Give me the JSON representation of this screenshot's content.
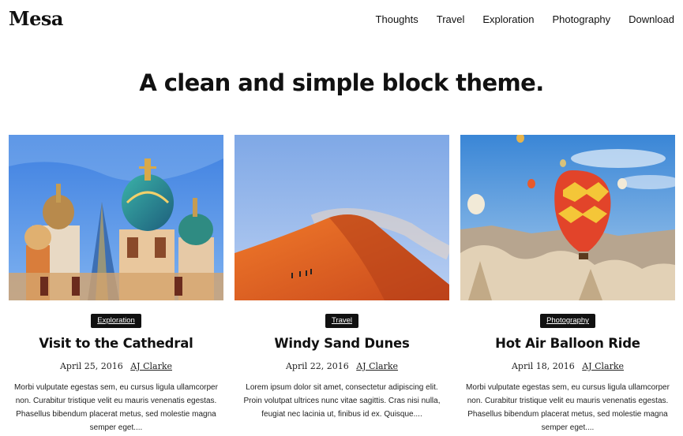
{
  "site": {
    "logo": "Mesa",
    "tagline": "A clean and simple block theme."
  },
  "nav": {
    "items": [
      "Thoughts",
      "Travel",
      "Exploration",
      "Photography",
      "Download"
    ]
  },
  "posts": [
    {
      "category": "Exploration",
      "title": "Visit to the Cathedral",
      "date": "April 25, 2016",
      "author": "AJ Clarke",
      "excerpt": "Morbi vulputate egestas sem, eu cursus ligula ullamcorper non. Curabitur tristique velit eu mauris venenatis egestas. Phasellus bibendum placerat metus, sed molestie magna semper eget....",
      "image": "cathedral-domes-photo"
    },
    {
      "category": "Travel",
      "title": "Windy Sand Dunes",
      "date": "April 22, 2016",
      "author": "AJ Clarke",
      "excerpt": "Lorem ipsum dolor sit amet, consectetur adipiscing elit. Proin volutpat ultrices nunc vitae sagittis. Cras nisi nulla, feugiat nec lacinia ut, finibus id ex. Quisque....",
      "image": "sand-dunes-photo"
    },
    {
      "category": "Photography",
      "title": "Hot Air Balloon Ride",
      "date": "April 18, 2016",
      "author": "AJ Clarke",
      "excerpt": "Morbi vulputate egestas sem, eu cursus ligula ullamcorper non. Curabitur tristique velit eu mauris venenatis egestas. Phasellus bibendum placerat metus, sed molestie magna semper eget....",
      "image": "hot-air-balloons-photo"
    }
  ]
}
